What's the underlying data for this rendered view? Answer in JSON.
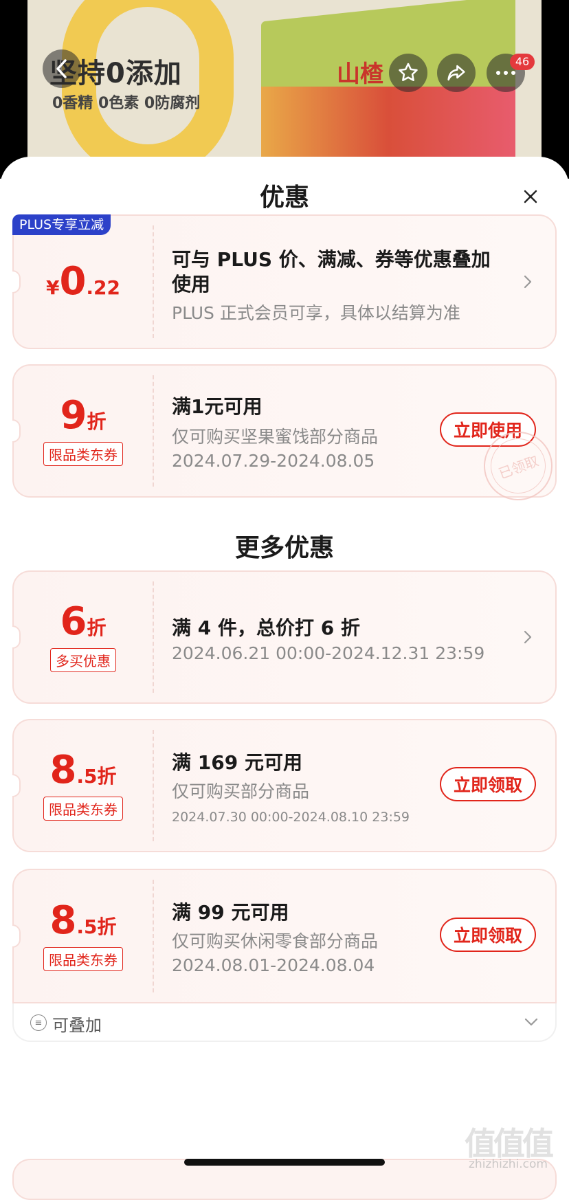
{
  "banner": {
    "slogan": "坚持0添加",
    "subslogan": "0香精  0色素  0防腐剂",
    "product_title": "山楂",
    "cart_count": "46"
  },
  "sheet": {
    "title": "优惠",
    "more_title": "更多优惠"
  },
  "cards": [
    {
      "tag_corner": "PLUS专享立减",
      "currency": "¥",
      "big": "0",
      "small": ".22",
      "line1": "可与 PLUS 价、满减、券等优惠叠加",
      "line1b": "使用",
      "line2": "PLUS 正式会员可享，具体以结算为准"
    },
    {
      "big": "9",
      "small": "折",
      "tag": "限品类东券",
      "line1": "满1元可用",
      "line2": "仅可购买坚果蜜饯部分商品",
      "line3": "2024.07.29-2024.08.05",
      "button": "立即使用",
      "stamp": "已领取"
    },
    {
      "big": "6",
      "small": "折",
      "tag": "多买优惠",
      "line1": "满 4 件，总价打 6 折",
      "line2": "2024.06.21 00:00-2024.12.31 23:59"
    },
    {
      "big": "8",
      "small": ".5折",
      "tag": "限品类东券",
      "line1": "满 169 元可用",
      "line2": "仅可购买部分商品",
      "line3": "2024.07.30 00:00-2024.08.10 23:59",
      "button": "立即领取"
    },
    {
      "big": "8",
      "small": ".5折",
      "tag": "限品类东券",
      "line1": "满 99 元可用",
      "line2": "仅可购买休闲零食部分商品",
      "line3": "2024.08.01-2024.08.04",
      "button": "立即领取"
    }
  ],
  "stack": {
    "label": "可叠加"
  },
  "watermark": {
    "logo": "值值值",
    "url": "zhizhizhi.com"
  },
  "colors": {
    "accent": "#e1251b",
    "plus_blue": "#2c41c9"
  }
}
